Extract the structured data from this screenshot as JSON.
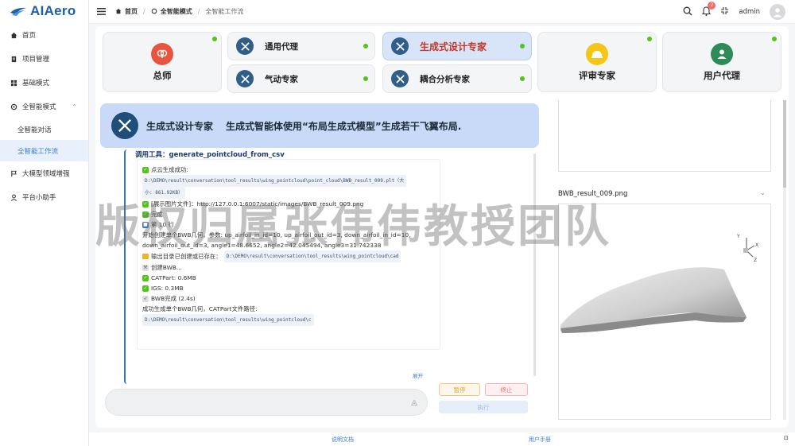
{
  "app": {
    "logo_text": "AIAero"
  },
  "sidebar": {
    "items": [
      {
        "label": "首页",
        "icon": "home-icon"
      },
      {
        "label": "项目管理",
        "icon": "clipboard-icon"
      },
      {
        "label": "基础模式",
        "icon": "grid-icon"
      },
      {
        "label": "全智能模式",
        "icon": "gear-icon"
      },
      {
        "label": "全智能对话",
        "sub": true
      },
      {
        "label": "全智能工作流",
        "sub": true,
        "active": true
      },
      {
        "label": "大模型领域增强",
        "icon": "flag-icon"
      },
      {
        "label": "平台小助手",
        "icon": "user-icon"
      }
    ]
  },
  "topbar": {
    "breadcrumb": {
      "home": "首页",
      "mode": "全智能模式",
      "current": "全智能工作流"
    },
    "notification_count": "2",
    "user": "admin"
  },
  "agents": {
    "teacher": "总师",
    "general": "通用代理",
    "generative": "生成式设计专家",
    "aero": "气动专家",
    "coupling": "耦合分析专家",
    "review": "评审专家",
    "user_proxy": "用户代理"
  },
  "banner": {
    "title": "生成式设计专家",
    "description": "生成式智能体使用“布局生成式模型”生成若干飞翼布局."
  },
  "chat": {
    "tool_call": "调用工具：generate_pointcloud_from_csv",
    "lines": {
      "l1": "点云生成成功:",
      "l2_path": "D:\\DEMO\\result\\conversation\\tool_results\\wing_pointcloud\\point_cloud\\BWB_result_009.plt（大",
      "l3_size": "小: 861.92KB）",
      "l4": "[展示图片文件]：http://127.0.0.1:6007/static/images/BWB_result_009.png",
      "l5": "完成",
      "l6": "第 10 行",
      "l7": "开始创建单个BWB几何，参数: up_airfoil_in_id=10, up_airfoil_out_id=3, down_airfoil_in_id=10,",
      "l8": "down_airfoil_out_id=3, angle1=48.6652, angle2=42.045494, angle3=31.742338",
      "l9_label": "输出目录已创建或已存在：",
      "l9_path": "D:\\DEMO\\result\\conversation\\tool_results\\wing_pointcloud\\cad",
      "l10": "创建BWB...",
      "l11": "CATPart: 0.6MB",
      "l12": "IGS: 0.3MB",
      "l13": "BWB完成 (2.4s)",
      "l14": "成功生成单个BWB几何，CATPart文件路径:",
      "l15_path": "D:\\DEMO\\result\\conversation\\tool_results\\wing_pointcloud\\c"
    },
    "expand": "展开"
  },
  "controls": {
    "pause": "暂停",
    "stop": "终止",
    "run": "执行"
  },
  "image_panel": {
    "title": "BWB_result_009.png",
    "axes": {
      "x": "X",
      "y": "Y",
      "z": "Z"
    }
  },
  "watermark": "版权归属张伟伟教授团队",
  "footer": {
    "docs": "说明文档",
    "manual": "用户手册"
  }
}
